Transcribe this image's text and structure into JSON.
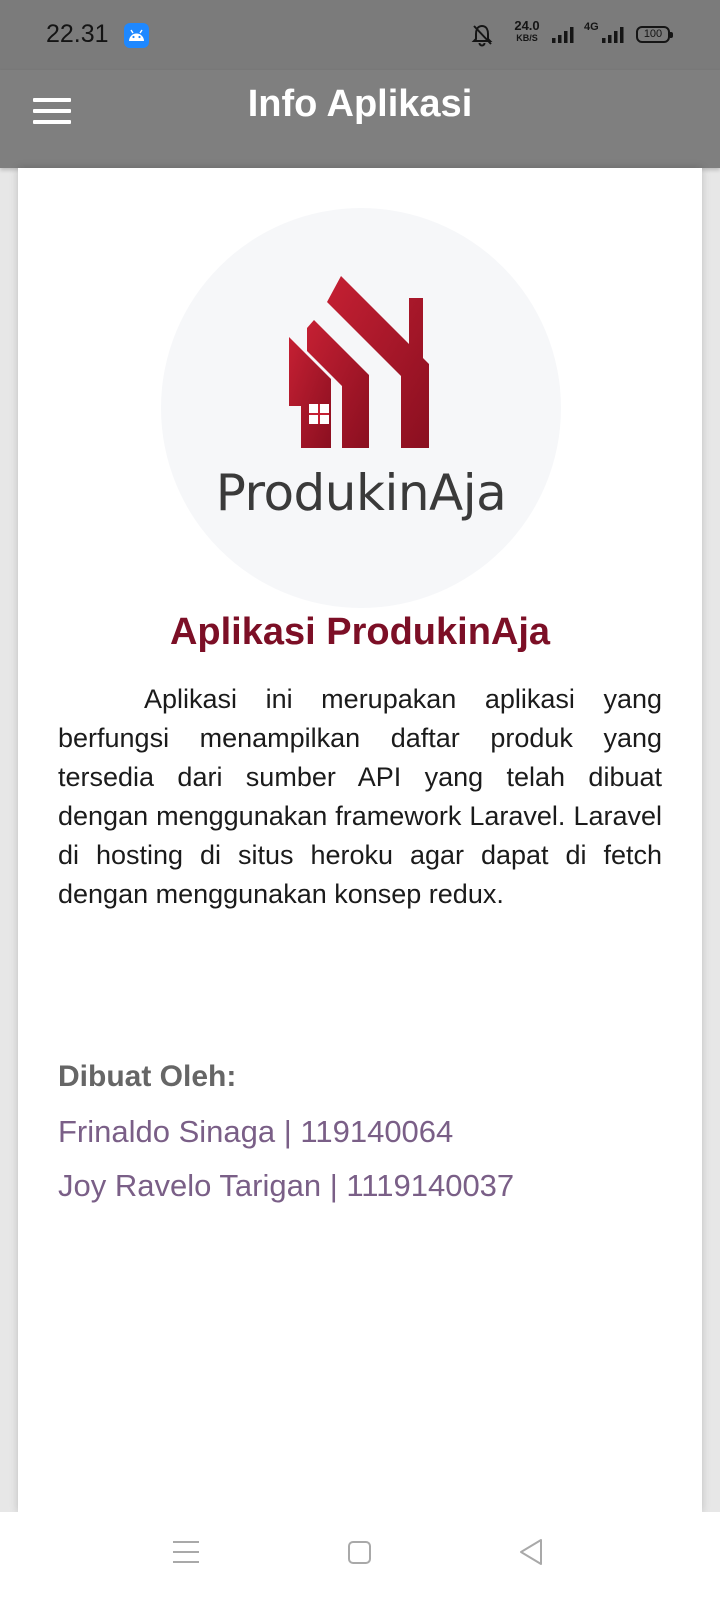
{
  "status_bar": {
    "time": "22.31",
    "network_speed": "24.0",
    "network_speed_unit": "KB/S",
    "network_type": "4G",
    "battery": "100",
    "icons": [
      "android-icon",
      "bell-off-icon",
      "signal-icon",
      "signal-icon",
      "battery-icon"
    ]
  },
  "app_bar": {
    "title": "Info Aplikasi",
    "menu_icon": "hamburger-menu-icon"
  },
  "content": {
    "logo_text": "ProdukinAja",
    "app_title": "Aplikasi ProdukinAja",
    "description": "Aplikasi ini merupakan aplikasi yang berfungsi menampilkan daftar produk yang tersedia dari sumber API yang telah dibuat dengan menggunakan framework Laravel. Laravel di hosting di situs heroku agar dapat di fetch dengan menggunakan konsep redux.",
    "credits_heading": "Dibuat Oleh:",
    "credits": [
      "Frinaldo Sinaga | 119140064",
      "Joy Ravelo Tarigan | 1119140037"
    ]
  },
  "nav_bar": {
    "icons": [
      "recent-apps-icon",
      "home-icon",
      "back-icon"
    ]
  },
  "colors": {
    "app_bar": "#7f7f7f",
    "title_accent": "#7c0f26",
    "logo_red": "#b01e2f",
    "credit_text": "#7a5f87",
    "credit_heading": "#666666"
  }
}
